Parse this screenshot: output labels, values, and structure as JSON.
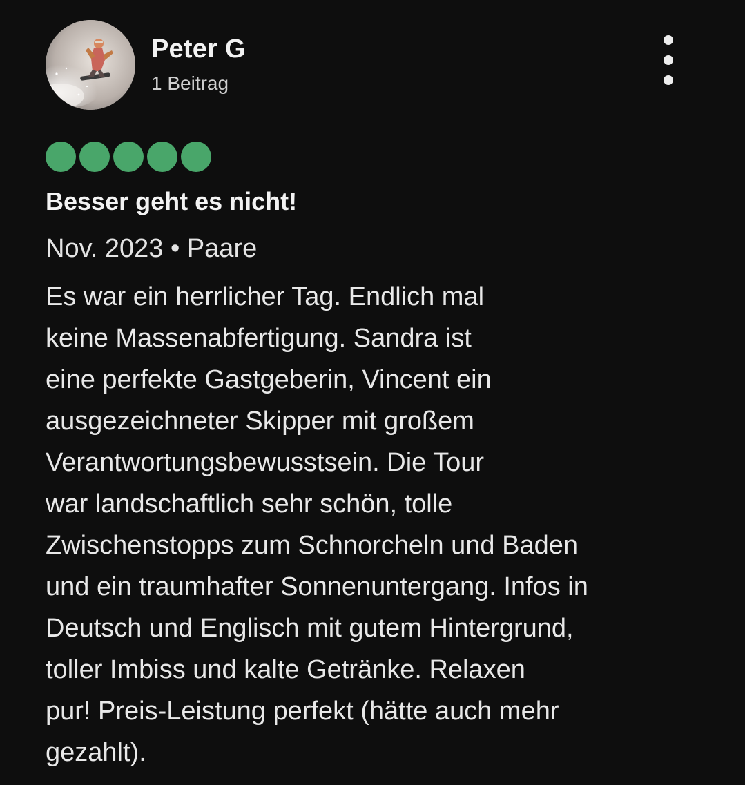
{
  "review": {
    "user": {
      "name": "Peter G",
      "contributions": "1 Beitrag",
      "avatar_icon": "snowboarder-photo-avatar"
    },
    "menu_icon": "more-vertical-icon",
    "rating": {
      "value": 5,
      "max": 5,
      "color": "#49a66a",
      "icon": "rating-bubble-icon"
    },
    "title": "Besser geht es nicht!",
    "meta": "Nov. 2023 • Paare",
    "body_lines": [
      "Es war ein herrlicher Tag. Endlich mal",
      "keine Massenabfertigung. Sandra ist",
      "eine perfekte Gastgeberin, Vincent ein",
      "ausgezeichneter Skipper mit großem",
      "Verantwortungsbewusstsein. Die Tour",
      "war landschaftlich sehr schön, tolle",
      "Zwischenstopps zum Schnorcheln und Baden",
      "und ein traumhafter Sonnenuntergang. Infos in",
      "Deutsch und Englisch mit gutem Hintergrund,",
      "toller Imbiss und kalte Getränke. Relaxen",
      "pur! Preis-Leistung perfekt (hätte auch mehr",
      "gezahlt)."
    ]
  },
  "colors": {
    "background": "#0e0e0e",
    "text": "#e8e8e8",
    "bubble_filled": "#49a66a"
  }
}
